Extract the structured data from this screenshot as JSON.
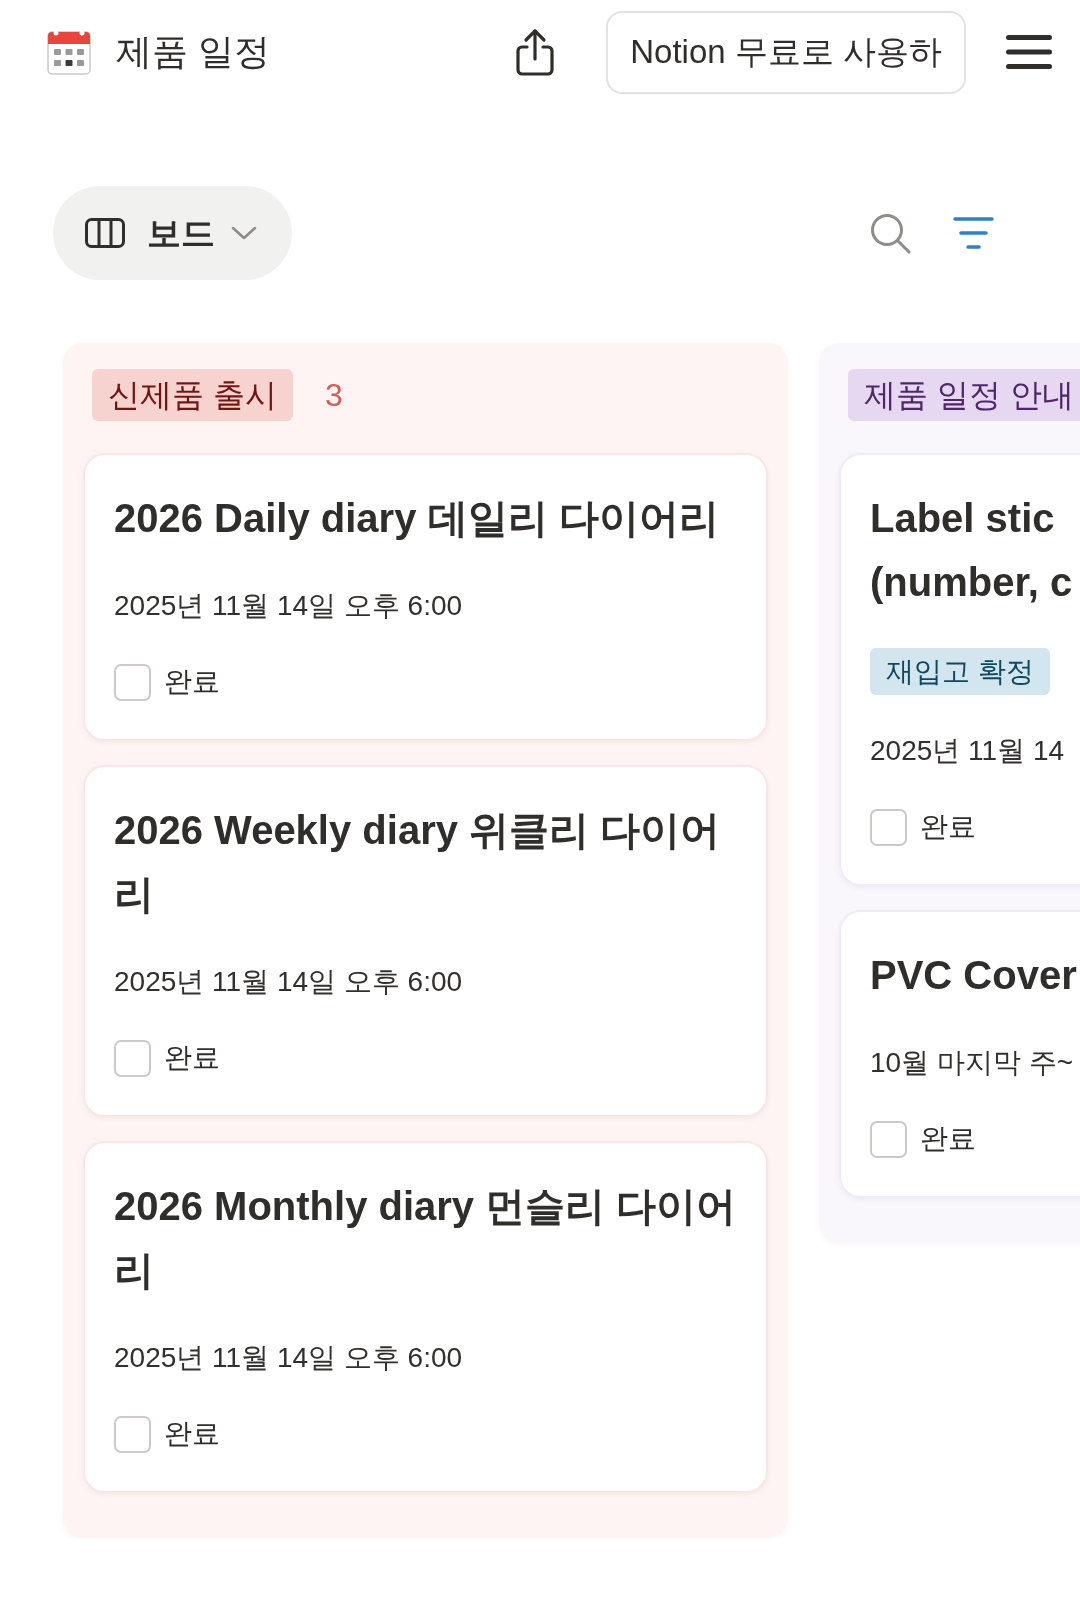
{
  "header": {
    "page_title": "제품 일정",
    "cta_button": "Notion 무료로 사용하"
  },
  "view_switcher": {
    "label": "보드"
  },
  "board": {
    "columns": [
      {
        "tag": "신제품 출시",
        "color": "#f6d3ce",
        "count": "3",
        "cards": [
          {
            "title": "2026 Daily diary 데일리 다이어리",
            "date": "2025년 11월 14일 오후 6:00",
            "done": {
              "label": "완료",
              "checked": false
            }
          },
          {
            "title": "2026 Weekly diary 위클리 다이어리",
            "date": "2025년 11월 14일 오후 6:00",
            "done": {
              "label": "완료",
              "checked": false
            }
          },
          {
            "title": "2026 Monthly diary 먼슬리 다이어리",
            "date": "2025년 11월 14일 오후 6:00",
            "done": {
              "label": "완료",
              "checked": false
            }
          }
        ]
      },
      {
        "tag": "제품 일정 안내",
        "color": "#e6d8f1",
        "cards": [
          {
            "title": "Label stic\n(number, c",
            "tags": [
              {
                "text": "재입고 확정",
                "color": "#d3e5ef"
              }
            ],
            "date": "2025년 11월 14",
            "done": {
              "label": "완료",
              "checked": false
            }
          },
          {
            "title": "PVC Cover",
            "date": "10월 마지막 주~",
            "done": {
              "label": "완료",
              "checked": false
            }
          }
        ]
      }
    ]
  }
}
